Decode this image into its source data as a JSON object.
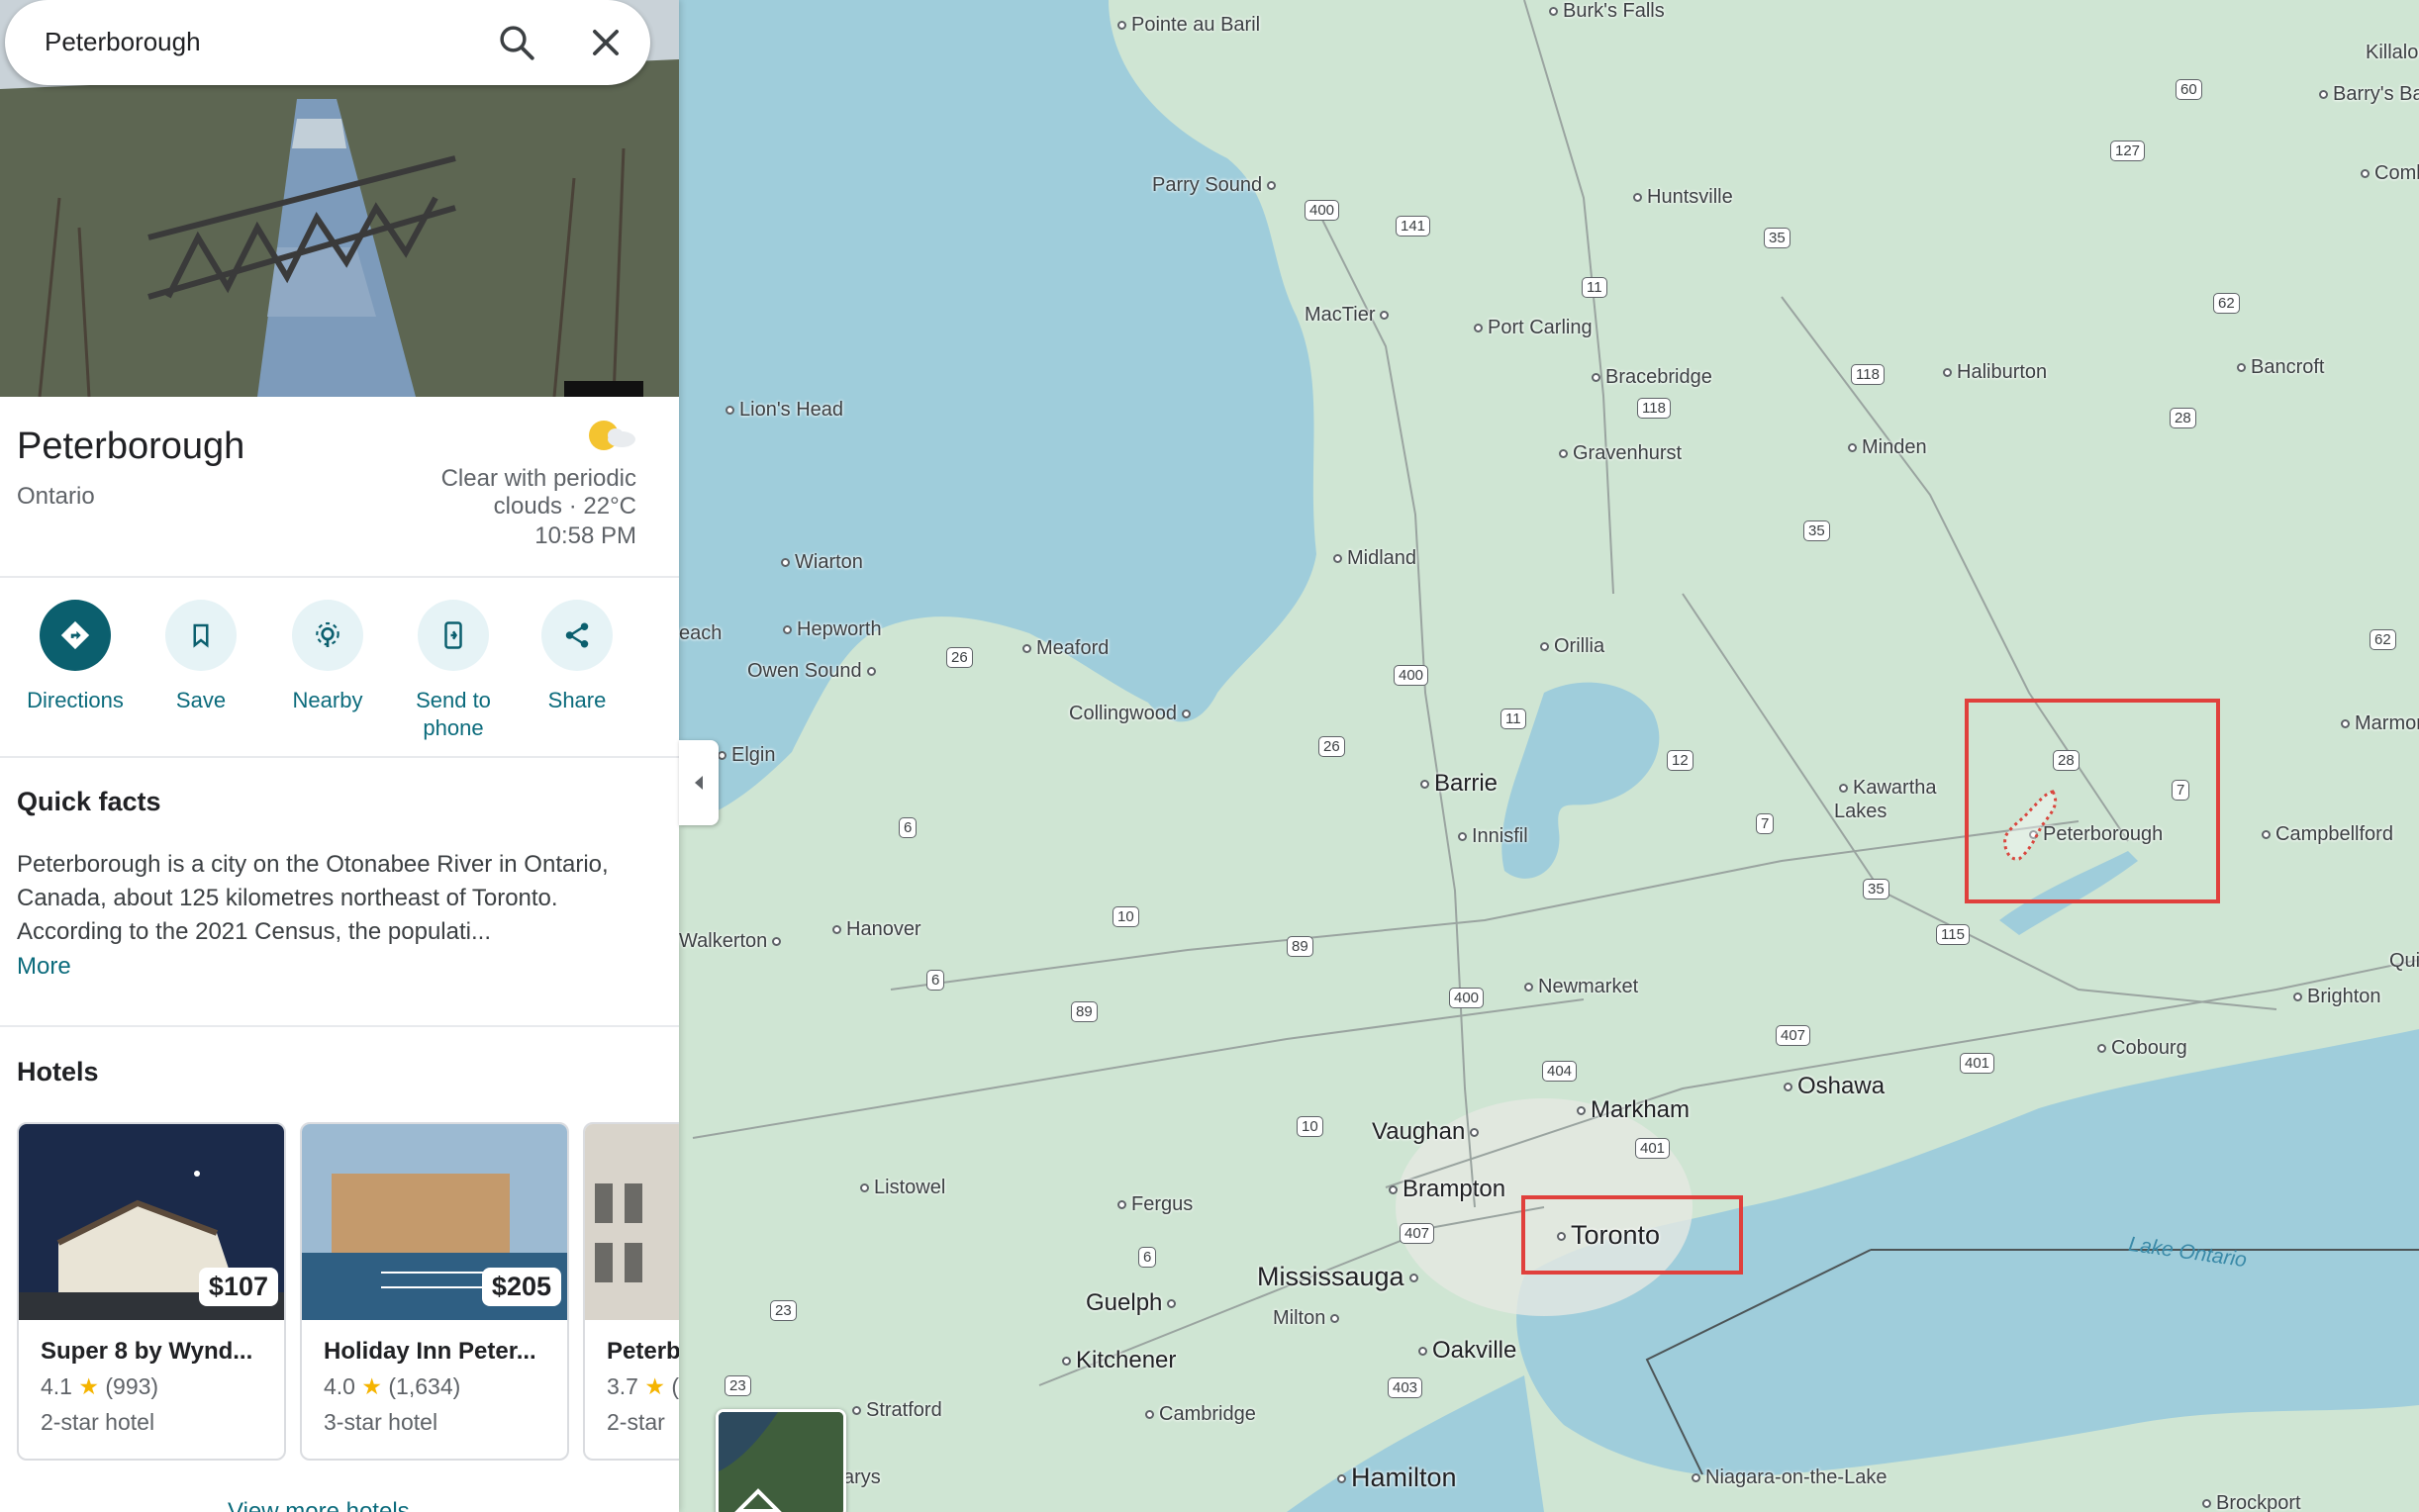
{
  "search": {
    "query": "Peterborough"
  },
  "place": {
    "title": "Peterborough",
    "subtitle": "Ontario",
    "weather": {
      "description": "Clear with periodic clouds · 22°C",
      "time": "10:58 PM",
      "icon": "partly-cloudy-night-icon"
    }
  },
  "actions": [
    {
      "label": "Directions",
      "icon": "directions-icon"
    },
    {
      "label": "Save",
      "icon": "bookmark-icon"
    },
    {
      "label": "Nearby",
      "icon": "nearby-icon"
    },
    {
      "label": "Send to\nphone",
      "icon": "send-to-phone-icon"
    },
    {
      "label": "Share",
      "icon": "share-icon"
    }
  ],
  "quick_facts": {
    "title": "Quick facts",
    "text": "Peterborough is a city on the Otonabee River in Ontario, Canada, about 125 kilometres northeast of Toronto. According to the 2021 Census, the populati...",
    "more": "More"
  },
  "hotels": {
    "title": "Hotels",
    "items": [
      {
        "name": "Super 8 by Wynd...",
        "rating": "4.1",
        "reviews": "(993)",
        "class": "2-star hotel",
        "price": "$107"
      },
      {
        "name": "Holiday Inn Peter...",
        "rating": "4.0",
        "reviews": "(1,634)",
        "class": "3-star hotel",
        "price": "$205"
      },
      {
        "name": "Peterb",
        "rating": "3.7",
        "reviews": "(",
        "class": "2-star",
        "price": ""
      }
    ],
    "view_more": "View more hotels"
  },
  "map": {
    "places": [
      {
        "name": "Pointe au Baril"
      },
      {
        "name": "Burk's Falls"
      },
      {
        "name": "Killaloe"
      },
      {
        "name": "Barry's Ba"
      },
      {
        "name": "Combe"
      },
      {
        "name": "Parry Sound"
      },
      {
        "name": "Huntsville"
      },
      {
        "name": "MacTier"
      },
      {
        "name": "Port Carling"
      },
      {
        "name": "Bracebridge"
      },
      {
        "name": "Haliburton"
      },
      {
        "name": "Bancroft"
      },
      {
        "name": "Lion's Head"
      },
      {
        "name": "Gravenhurst"
      },
      {
        "name": "Minden"
      },
      {
        "name": "Wiarton"
      },
      {
        "name": "Midland"
      },
      {
        "name": "each"
      },
      {
        "name": "Hepworth"
      },
      {
        "name": "Owen Sound"
      },
      {
        "name": "Meaford"
      },
      {
        "name": "Orillia"
      },
      {
        "name": "Collingwood"
      },
      {
        "name": "Marmora"
      },
      {
        "name": "Elgin"
      },
      {
        "name": "Barrie"
      },
      {
        "name": "Kawartha\nLakes"
      },
      {
        "name": "Peterborough"
      },
      {
        "name": "Campbellford"
      },
      {
        "name": "Innisfil"
      },
      {
        "name": "Walkerton"
      },
      {
        "name": "Hanover"
      },
      {
        "name": "Quin"
      },
      {
        "name": "Newmarket"
      },
      {
        "name": "Brighton"
      },
      {
        "name": "Cobourg"
      },
      {
        "name": "Oshawa"
      },
      {
        "name": "Markham"
      },
      {
        "name": "Vaughan"
      },
      {
        "name": "Listowel"
      },
      {
        "name": "Brampton"
      },
      {
        "name": "Fergus"
      },
      {
        "name": "Toronto"
      },
      {
        "name": "Mississauga"
      },
      {
        "name": "Guelph"
      },
      {
        "name": "Milton"
      },
      {
        "name": "Kitchener"
      },
      {
        "name": "Oakville"
      },
      {
        "name": "Stratford"
      },
      {
        "name": "Cambridge"
      },
      {
        "name": "Hamilton"
      },
      {
        "name": "Niagara-on-the-Lake"
      },
      {
        "name": "Brockport"
      },
      {
        "name": "arys"
      }
    ],
    "water_label": "Lake Ontario",
    "route_shields": [
      "60",
      "127",
      "400",
      "141",
      "35",
      "11",
      "62",
      "118",
      "118",
      "28",
      "35",
      "26",
      "400",
      "11",
      "62",
      "26",
      "12",
      "28",
      "7",
      "7",
      "6",
      "10",
      "89",
      "35",
      "115",
      "6",
      "89",
      "400",
      "407",
      "404",
      "10",
      "401",
      "401",
      "407",
      "6",
      "23",
      "23",
      "403"
    ]
  }
}
